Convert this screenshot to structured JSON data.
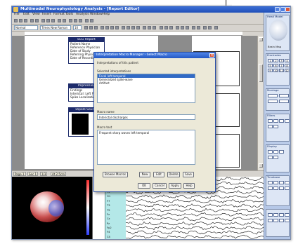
{
  "app": {
    "title": "Multimodal Neurophysiology Analysis - [Report Editor]"
  },
  "menus": [
    "File",
    "Edit",
    "View",
    "Insert",
    "Format",
    "Tools",
    "Analysis",
    "Window",
    "Help"
  ],
  "toolbar": {
    "style_value": "Normal",
    "font_value": "Times New Roman",
    "size_value": "10"
  },
  "report_panels": [
    {
      "title": "EEG Report",
      "items": [
        "Patient Name",
        "Reference Physician",
        "Date of Study",
        "Referring Physician",
        "Date of Recording"
      ]
    },
    {
      "title": "Impression",
      "items": [
        "Findings",
        "Interictal: Left Frontal",
        "Spike Localization"
      ]
    },
    {
      "title": "Dipole Source",
      "items": []
    }
  ],
  "status_tabs": [
    "Page 1",
    "Sec 1",
    "1/3",
    "At 2.5cm"
  ],
  "dialog": {
    "title": "Interpretation Macro Manager - Select Macro",
    "heading": "Interpretations of this patient",
    "list_label": "Selected interpretations",
    "list_items": [
      "Focal left temporal",
      "Generalized spike-wave",
      "Artifact"
    ],
    "field_label": "Macro name",
    "field_value": "Interictal discharges",
    "text_label": "Macro text",
    "text_value": "Frequent sharp waves left temporal",
    "btn_browse": "Browse Macros",
    "btn_new": "New",
    "btn_edit": "Edit",
    "btn_delete": "Delete",
    "btn_save": "Save",
    "btn_ok": "OK",
    "btn_cancel": "Cancel",
    "btn_apply": "Apply",
    "btn_help": "Help"
  },
  "right_panel": {
    "sections": [
      "Head Model",
      "Electrodes",
      "Montage",
      "Filters",
      "Display",
      "Timebase"
    ],
    "head_label": "Brain Map",
    "buttons": [
      "1",
      "2",
      "3",
      "4",
      "5",
      "6",
      "7",
      "8",
      "9",
      "10",
      "11",
      "12"
    ]
  },
  "eeg": {
    "channels": [
      "Fp1",
      "F3",
      "C3",
      "P3",
      "O1",
      "F7",
      "T3",
      "T5",
      "Fz",
      "Cz",
      "Pz",
      "Fp2",
      "F4",
      "C4"
    ]
  },
  "colors": {
    "accent": "#2457c4",
    "panel_header": "#1d2b6b",
    "channel_strip": "#b4e8e8"
  }
}
